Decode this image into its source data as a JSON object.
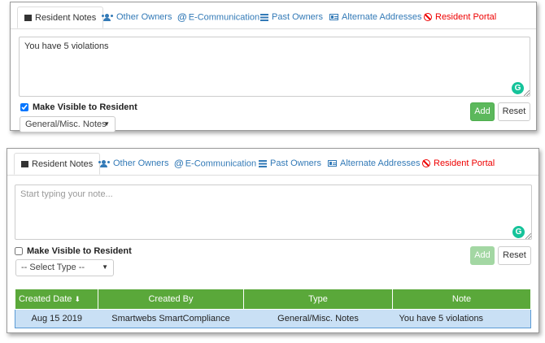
{
  "tabs": [
    {
      "label": "Resident Notes",
      "icon": "note-icon"
    },
    {
      "label": "Other Owners",
      "icon": "users-icon"
    },
    {
      "label": "E-Communication",
      "icon": "at-icon"
    },
    {
      "label": "Past Owners",
      "icon": "list-icon"
    },
    {
      "label": "Alternate Addresses",
      "icon": "address-card-icon"
    },
    {
      "label": "Resident Portal",
      "icon": "ban-icon"
    }
  ],
  "panel1": {
    "note_value": "You have 5 violations",
    "visible_label": "Make Visible to Resident",
    "visible_checked": true,
    "type_selected": "General/Misc. Notes",
    "add_label": "Add",
    "reset_label": "Reset"
  },
  "panel2": {
    "note_placeholder": "Start typing your note...",
    "visible_label": "Make Visible to Resident",
    "visible_checked": false,
    "type_selected": "-- Select Type --",
    "add_label": "Add",
    "reset_label": "Reset"
  },
  "grammarly_glyph": "G",
  "caret_glyph": "▼",
  "sort_glyph": "⬇",
  "table": {
    "headers": [
      "Created Date",
      "Created By",
      "Type",
      "Note"
    ],
    "rows": [
      [
        "Aug 15 2019",
        "Smartwebs SmartCompliance",
        "General/Misc. Notes",
        "You have 5 violations"
      ]
    ]
  },
  "colors": {
    "tab_link": "#337ab7",
    "portal_tab": "#e00000",
    "add_button": "#5cb85c",
    "table_header": "#5aa83a",
    "row_selected": "#c9e0f5",
    "grammarly": "#15c39a"
  }
}
